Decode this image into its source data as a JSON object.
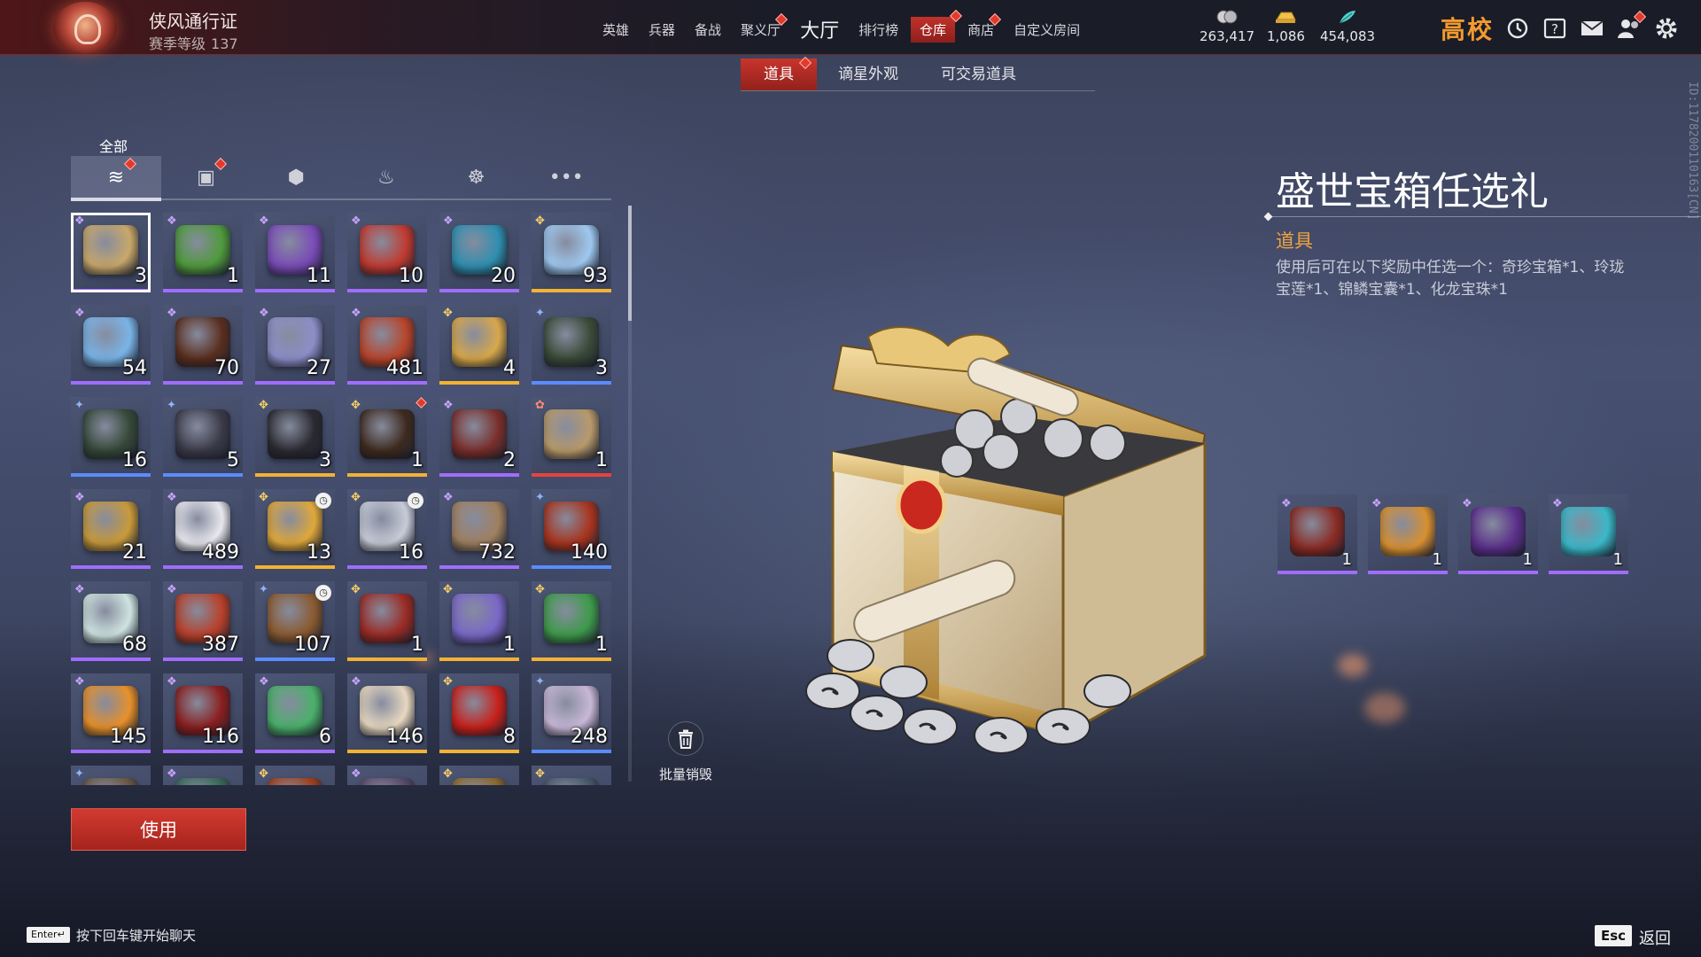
{
  "topbar": {
    "pass_title": "侠风通行证",
    "season_label": "赛季等级",
    "season_level": "137",
    "nav": [
      {
        "label": "英雄",
        "dot": false
      },
      {
        "label": "兵器",
        "dot": false
      },
      {
        "label": "备战",
        "dot": false
      },
      {
        "label": "聚义厅",
        "dot": true
      },
      {
        "label": "大厅",
        "dot": false,
        "big": true
      },
      {
        "label": "排行榜",
        "dot": false
      },
      {
        "label": "仓库",
        "dot": true,
        "active": true
      },
      {
        "label": "商店",
        "dot": true
      },
      {
        "label": "自定义房间",
        "dot": false
      }
    ],
    "currencies": [
      {
        "icon": "coin-icon",
        "value": "263,417",
        "color": "#d8d8dc"
      },
      {
        "icon": "gold-ingot-icon",
        "value": "1,086",
        "color": "#f2c14a"
      },
      {
        "icon": "jade-feather-icon",
        "value": "454,083",
        "color": "#4fd0c8"
      }
    ],
    "logo_text": "高校",
    "icons": [
      "clock-icon",
      "help-book-icon",
      "mail-icon",
      "friends-icon",
      "settings-icon"
    ]
  },
  "subtabs": [
    {
      "label": "道具",
      "active": true,
      "dot": true
    },
    {
      "label": "谪星外观",
      "active": false,
      "dot": false
    },
    {
      "label": "可交易道具",
      "active": false,
      "dot": false
    }
  ],
  "categories": {
    "active_label": "全部",
    "tabs": [
      {
        "name": "all-items-icon",
        "glyph": "≋",
        "dot": true,
        "active": true
      },
      {
        "name": "gift-icon",
        "glyph": "▣",
        "dot": true,
        "active": false
      },
      {
        "name": "badge-icon",
        "glyph": "⬢",
        "dot": false,
        "active": false
      },
      {
        "name": "flame-icon",
        "glyph": "♨",
        "dot": false,
        "active": false
      },
      {
        "name": "swirl-icon",
        "glyph": "☸",
        "dot": false,
        "active": false
      },
      {
        "name": "more-icon",
        "glyph": "•••",
        "dot": false,
        "active": false
      }
    ]
  },
  "inventory": [
    {
      "count": "3",
      "quality": "purple",
      "mark": "purple",
      "color": "#c9a86a",
      "selected": true
    },
    {
      "count": "1",
      "quality": "purple",
      "mark": "purple",
      "color": "#4f9a3c"
    },
    {
      "count": "11",
      "quality": "purple",
      "mark": "purple",
      "color": "#7a4bb8"
    },
    {
      "count": "10",
      "quality": "purple",
      "mark": "purple",
      "color": "#c13a30"
    },
    {
      "count": "20",
      "quality": "purple",
      "mark": "purple",
      "color": "#2f8fb0"
    },
    {
      "count": "93",
      "quality": "gold",
      "mark": "gold",
      "color": "#9fc8f0"
    },
    {
      "count": "54",
      "quality": "purple",
      "mark": "purple",
      "color": "#7ab4e8"
    },
    {
      "count": "70",
      "quality": "purple",
      "mark": "purple",
      "color": "#5a2e1e"
    },
    {
      "count": "27",
      "quality": "purple",
      "mark": "purple",
      "color": "#8d8ec8"
    },
    {
      "count": "481",
      "quality": "purple",
      "mark": "purple",
      "color": "#b8442a"
    },
    {
      "count": "4",
      "quality": "gold",
      "mark": "gold",
      "color": "#d8a84a"
    },
    {
      "count": "3",
      "quality": "blue",
      "mark": "blue",
      "color": "#3a4a38"
    },
    {
      "count": "16",
      "quality": "blue",
      "mark": "blue",
      "color": "#354838"
    },
    {
      "count": "5",
      "quality": "blue",
      "mark": "blue",
      "color": "#3a3a48"
    },
    {
      "count": "3",
      "quality": "gold",
      "mark": "gold",
      "color": "#2a2a30"
    },
    {
      "count": "1",
      "quality": "gold",
      "mark": "gold",
      "color": "#3e2a1e",
      "dot": true
    },
    {
      "count": "2",
      "quality": "purple",
      "mark": "purple",
      "color": "#7a2e2a"
    },
    {
      "count": "1",
      "quality": "red",
      "mark": "red",
      "color": "#b89a6a"
    },
    {
      "count": "21",
      "quality": "purple",
      "mark": "purple",
      "color": "#c99a3a"
    },
    {
      "count": "489",
      "quality": "purple",
      "mark": "purple",
      "color": "#e8e8ee"
    },
    {
      "count": "13",
      "quality": "gold",
      "mark": "gold",
      "color": "#e0a83a",
      "timer": true
    },
    {
      "count": "16",
      "quality": "purple",
      "mark": "gold",
      "color": "#c8ccd8",
      "timer": true
    },
    {
      "count": "732",
      "quality": "purple",
      "mark": "purple",
      "color": "#a08060"
    },
    {
      "count": "140",
      "quality": "blue",
      "mark": "blue",
      "color": "#a8341e"
    },
    {
      "count": "68",
      "quality": "purple",
      "mark": "purple",
      "color": "#cfe4e0"
    },
    {
      "count": "387",
      "quality": "purple",
      "mark": "purple",
      "color": "#b8402a"
    },
    {
      "count": "107",
      "quality": "blue",
      "mark": "blue",
      "color": "#8a5a30",
      "timer": true
    },
    {
      "count": "1",
      "quality": "gold",
      "mark": "gold",
      "color": "#9a2a24"
    },
    {
      "count": "1",
      "quality": "gold",
      "mark": "gold",
      "color": "#7a68c8"
    },
    {
      "count": "1",
      "quality": "gold",
      "mark": "gold",
      "color": "#3e9a4a"
    },
    {
      "count": "145",
      "quality": "purple",
      "mark": "purple",
      "color": "#e8902a"
    },
    {
      "count": "116",
      "quality": "purple",
      "mark": "purple",
      "color": "#8a1e1e"
    },
    {
      "count": "6",
      "quality": "purple",
      "mark": "purple",
      "color": "#4ab06a"
    },
    {
      "count": "146",
      "quality": "gold",
      "mark": "purple",
      "color": "#e8d8c0"
    },
    {
      "count": "8",
      "quality": "gold",
      "mark": "gold",
      "color": "#c8201a"
    },
    {
      "count": "248",
      "quality": "blue",
      "mark": "blue",
      "color": "#c8b8d8"
    },
    {
      "count": "",
      "quality": "blue",
      "mark": "blue",
      "color": "#6a5a48"
    },
    {
      "count": "",
      "quality": "purple",
      "mark": "purple",
      "color": "#3a6a5a"
    },
    {
      "count": "",
      "quality": "gold",
      "mark": "gold",
      "color": "#a0401e"
    },
    {
      "count": "",
      "quality": "purple",
      "mark": "purple",
      "color": "#5a4a6a"
    },
    {
      "count": "",
      "quality": "gold",
      "mark": "gold",
      "color": "#8a6a30"
    },
    {
      "count": "",
      "quality": "gold",
      "mark": "gold",
      "color": "#4a5a6a"
    }
  ],
  "use_button": "使用",
  "destroy_button": "批量销毁",
  "detail": {
    "title": "盛世宝箱任选礼",
    "type": "道具",
    "description": "使用后可在以下奖励中任选一个：奇珍宝箱*1、玲珑宝莲*1、锦鳞宝囊*1、化龙宝珠*1",
    "rewards": [
      {
        "name": "treasure-chest",
        "count": "1",
        "color": "#8a2a22"
      },
      {
        "name": "lotus",
        "count": "1",
        "color": "#d89030"
      },
      {
        "name": "pouch",
        "count": "1",
        "color": "#5a2e8a"
      },
      {
        "name": "dragon-pearl",
        "count": "1",
        "color": "#3ab8c8"
      }
    ]
  },
  "vertical_id": "ID:1178200110163[CN]",
  "footer": {
    "enter_key": "Enter↵",
    "chat_hint": "按下回车键开始聊天",
    "esc_key": "Esc",
    "back_label": "返回"
  }
}
